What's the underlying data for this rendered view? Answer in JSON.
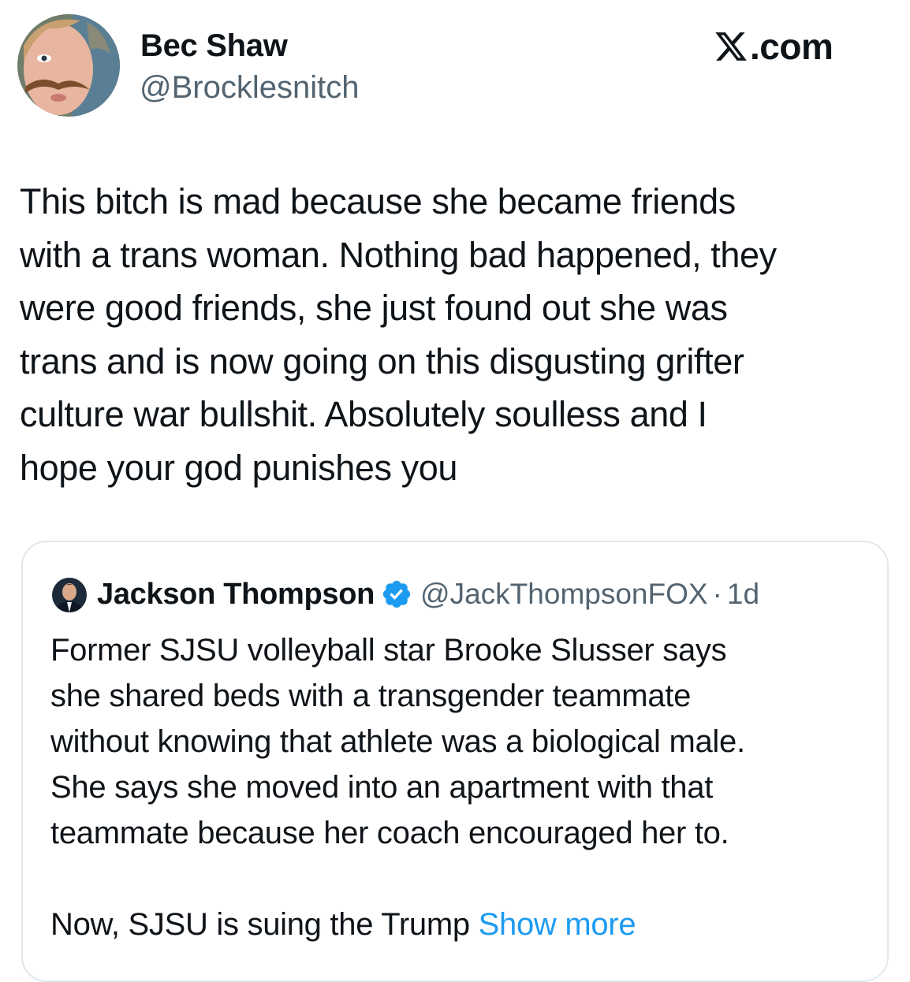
{
  "brand": {
    "label": ".com",
    "icon": "x-logo-icon"
  },
  "author": {
    "name": "Bec Shaw",
    "handle": "@Brocklesnitch",
    "avatar_icon": "profile-photo-avatar"
  },
  "tweet": {
    "lines": [
      "This bitch is mad because she became friends",
      "with a trans woman. Nothing bad happened, they",
      "were good friends, she just found out she was",
      "trans and is now going on this disgusting grifter",
      "culture war bullshit. Absolutely soulless and I",
      "hope your god punishes you"
    ]
  },
  "quoted": {
    "name": "Jackson Thompson",
    "verified_icon": "verified-badge-icon",
    "handle": "@JackThompsonFOX",
    "separator": "·",
    "time": "1d",
    "lines": [
      "Former SJSU volleyball star Brooke Slusser says",
      "she shared beds with a transgender teammate",
      "without knowing that athlete was a biological male.",
      "She says she moved into an apartment with that",
      "teammate because her coach encouraged her to."
    ],
    "last_line": "Now, SJSU is suing the Trump",
    "show_more": "Show more"
  },
  "colors": {
    "text": "#0f1419",
    "secondary": "#536471",
    "link": "#1d9bf0",
    "border": "#e1e8ed"
  }
}
